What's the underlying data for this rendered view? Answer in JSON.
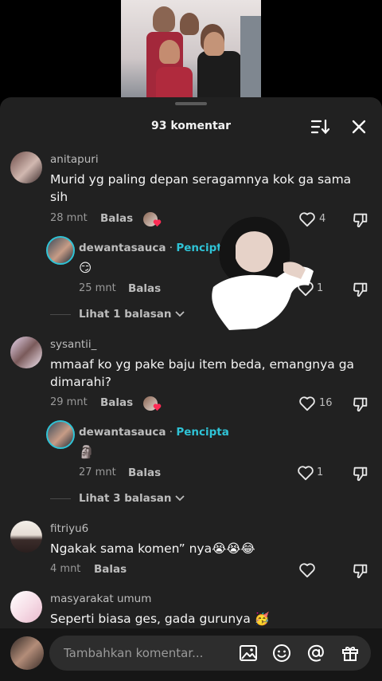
{
  "header": {
    "comment_count": "93 komentar"
  },
  "comments": [
    {
      "username": "anitapuri",
      "text": "Murid yg paling depan seragamnya kok ga sama sih",
      "time": "28 mnt",
      "reply_label": "Balas",
      "likes": "4",
      "replies": [
        {
          "username": "dewantasauca",
          "badge": "Pencipta",
          "text": "😏",
          "time": "25 mnt",
          "reply_label": "Balas",
          "likes": "1"
        }
      ],
      "more_replies": "Lihat 1 balasan"
    },
    {
      "username": "sysantii_",
      "text": "mmaaf ko yg pake baju item beda, emangnya ga dimarahi?",
      "time": "29 mnt",
      "reply_label": "Balas",
      "likes": "16",
      "replies": [
        {
          "username": "dewantasauca",
          "badge": "Pencipta",
          "text": "🗿",
          "time": "27 mnt",
          "reply_label": "Balas",
          "likes": "1"
        }
      ],
      "more_replies": "Lihat 3 balasan"
    },
    {
      "username": "fitriyu6",
      "text": "Ngakak sama komen” nya😭😭😂",
      "time": "4 mnt",
      "reply_label": "Balas",
      "likes": ""
    },
    {
      "username": "masyarakat umum",
      "text": "Seperti biasa ges, gada gurunya 🥳"
    }
  ],
  "input": {
    "placeholder": "Tambahkan komentar..."
  },
  "icons": [
    "sort-icon",
    "close-icon",
    "heart-icon",
    "dislike-icon",
    "chevron-down-icon",
    "image-icon",
    "emoji-icon",
    "mention-icon",
    "gift-icon"
  ],
  "colors": {
    "background": "#212121",
    "creator_badge": "#2fc3d6",
    "text": "#f5f5f5",
    "muted": "#9a9a9a"
  }
}
